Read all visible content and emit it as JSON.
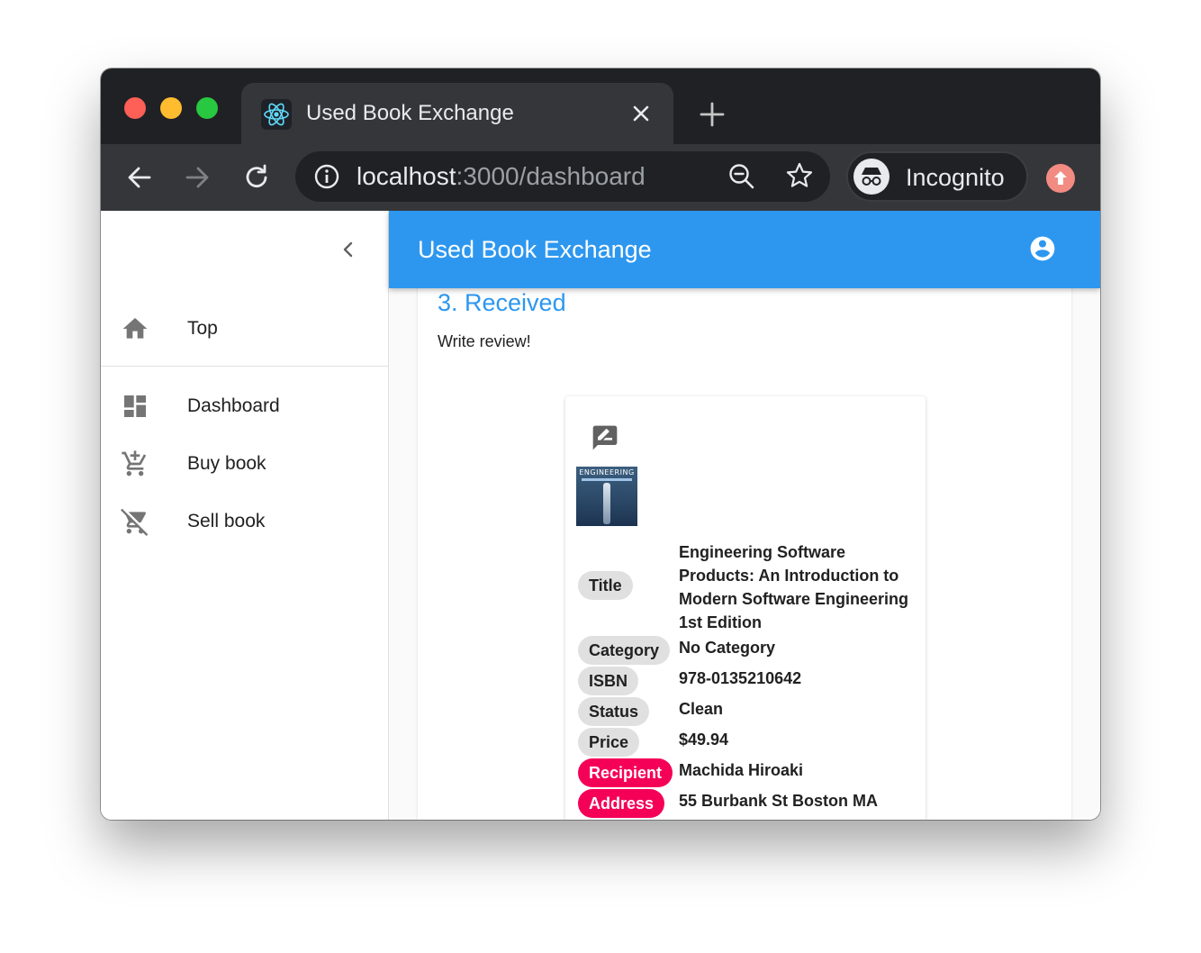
{
  "browser": {
    "tab_title": "Used Book Exchange",
    "url_host": "localhost",
    "url_path": ":3000/dashboard",
    "incognito_label": "Incognito"
  },
  "drawer": {
    "items": [
      {
        "label": "Top",
        "icon": "home-icon"
      },
      {
        "label": "Dashboard",
        "icon": "dashboard-icon"
      },
      {
        "label": "Buy book",
        "icon": "add-shopping-cart-icon"
      },
      {
        "label": "Sell book",
        "icon": "remove-shopping-cart-icon"
      }
    ]
  },
  "appbar": {
    "title": "Used Book Exchange"
  },
  "step": {
    "title": "3. Received",
    "description": "Write review!"
  },
  "book": {
    "cover_text": "ENGINEERING",
    "fields": [
      {
        "label": "Title",
        "value": "Engineering Software Products: An Introduction to Modern Software Engineering 1st Edition",
        "highlight": false
      },
      {
        "label": "Category",
        "value": "No Category",
        "highlight": false
      },
      {
        "label": "ISBN",
        "value": "978-0135210642",
        "highlight": false
      },
      {
        "label": "Status",
        "value": "Clean",
        "highlight": false
      },
      {
        "label": "Price",
        "value": "$49.94",
        "highlight": false
      },
      {
        "label": "Recipient",
        "value": "Machida Hiroaki",
        "highlight": true
      },
      {
        "label": "Address",
        "value": "55 Burbank St Boston MA",
        "highlight": true
      }
    ]
  },
  "colors": {
    "primary": "#2d97ef",
    "accent": "#f50057",
    "chip": "#e0e0e0"
  }
}
